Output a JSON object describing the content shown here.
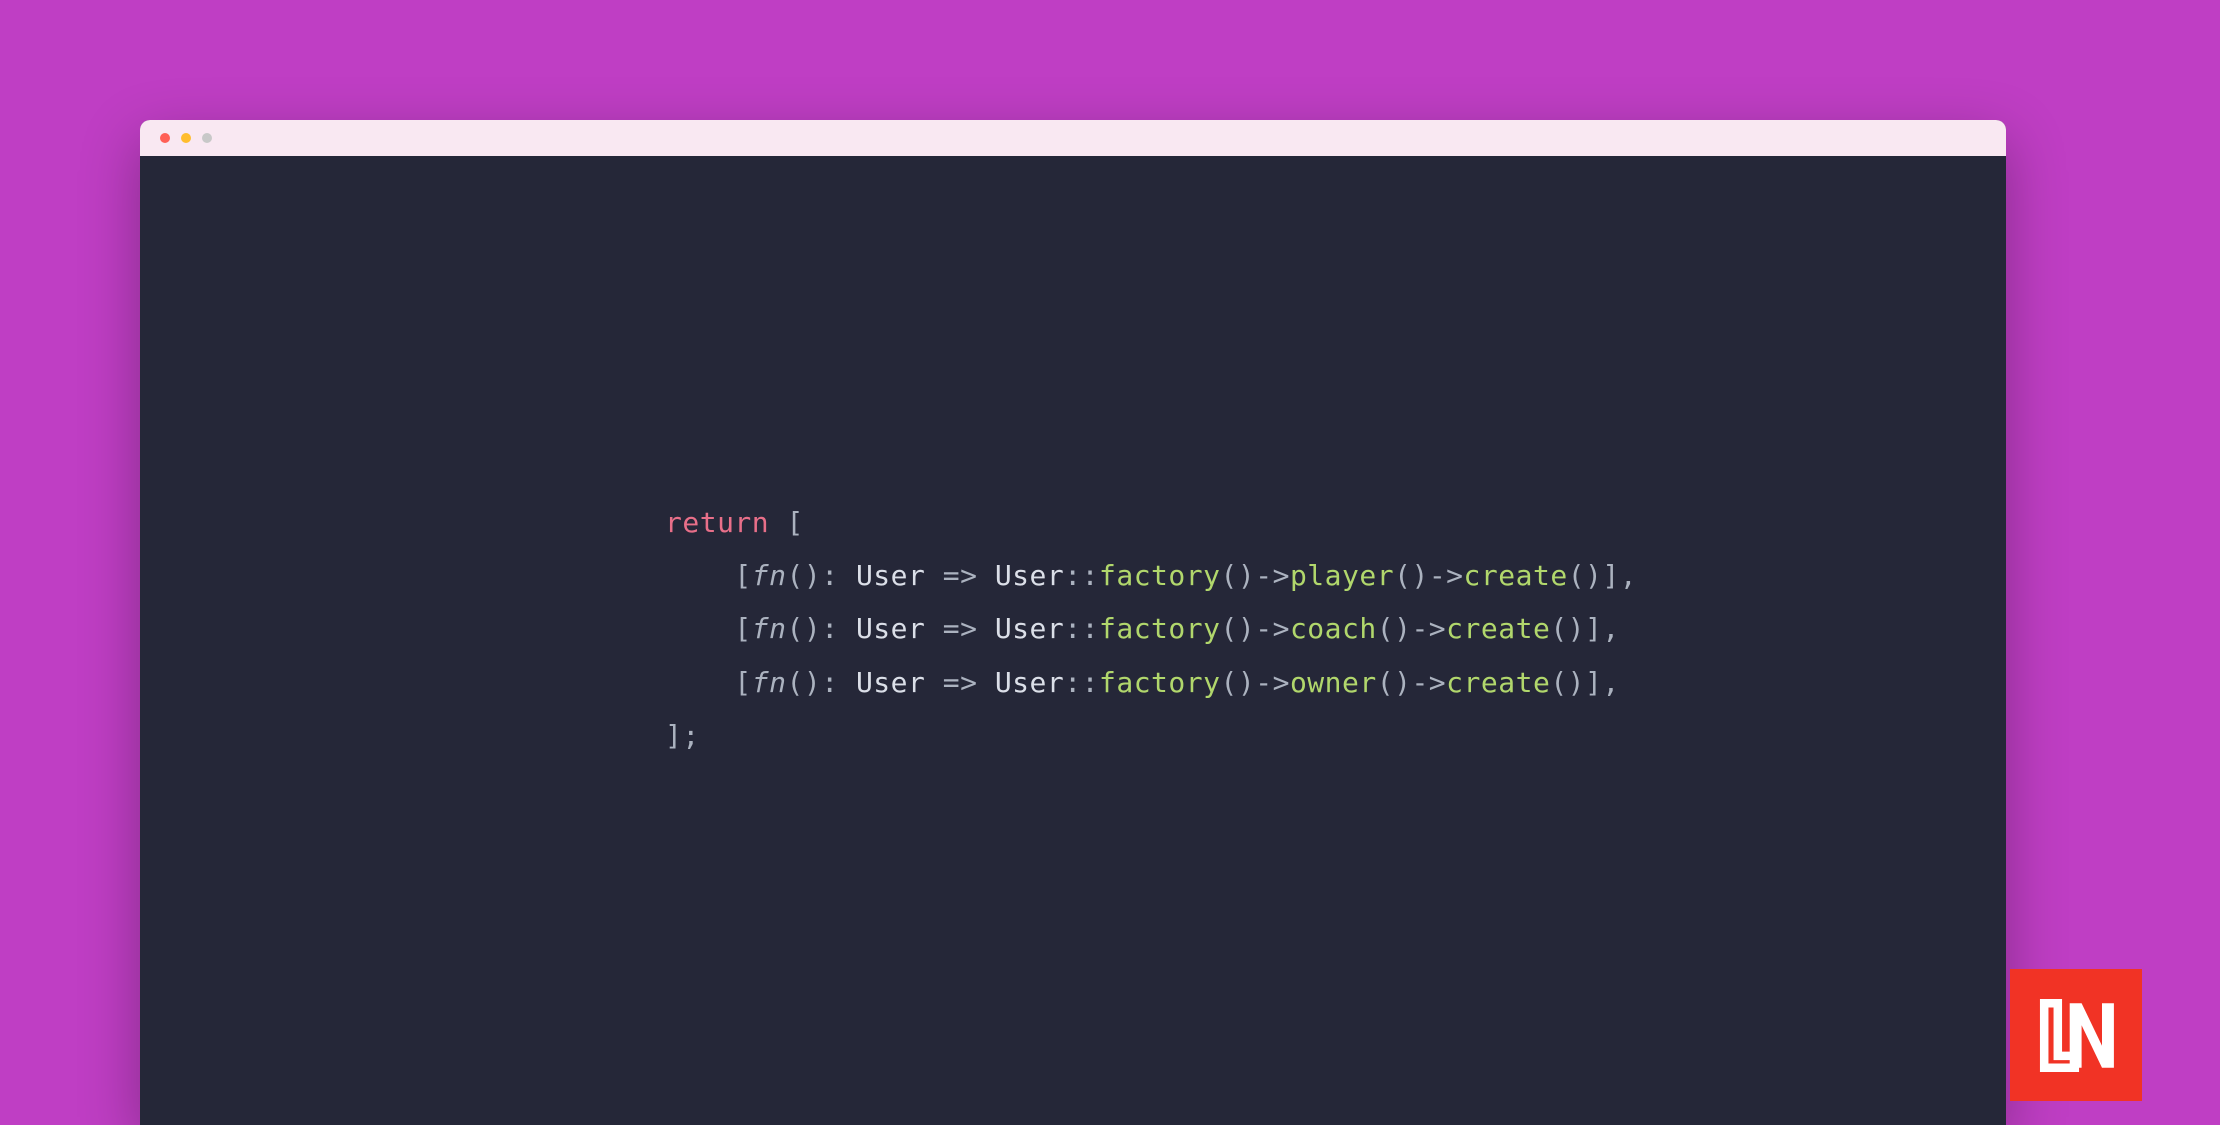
{
  "colors": {
    "background": "#bf3ec4",
    "editor": "#252738",
    "titlebar": "#f9e8f2",
    "keyword": "#e86f89",
    "method": "#b1d76c",
    "default": "#abb2bf",
    "brand": "#f13325"
  },
  "code": {
    "line1": {
      "keyword": "return",
      "after": " ["
    },
    "lines": [
      {
        "indent": "    [",
        "fn": "fn",
        "paren": "()",
        "colon": ": ",
        "type1": "User",
        "arrow": " => ",
        "type2": "User",
        "scope": "::",
        "m1": "factory",
        "p1": "()",
        "op1": "->",
        "m2": "player",
        "p2": "()",
        "op2": "->",
        "m3": "create",
        "p3": "()",
        "end": "],"
      },
      {
        "indent": "    [",
        "fn": "fn",
        "paren": "()",
        "colon": ": ",
        "type1": "User",
        "arrow": " => ",
        "type2": "User",
        "scope": "::",
        "m1": "factory",
        "p1": "()",
        "op1": "->",
        "m2": "coach",
        "p2": "()",
        "op2": "->",
        "m3": "create",
        "p3": "()",
        "end": "],"
      },
      {
        "indent": "    [",
        "fn": "fn",
        "paren": "()",
        "colon": ": ",
        "type1": "User",
        "arrow": " => ",
        "type2": "User",
        "scope": "::",
        "m1": "factory",
        "p1": "()",
        "op1": "->",
        "m2": "owner",
        "p2": "()",
        "op2": "->",
        "m3": "create",
        "p3": "()",
        "end": "],"
      }
    ],
    "close": "];"
  },
  "brand": {
    "name": "LN"
  }
}
